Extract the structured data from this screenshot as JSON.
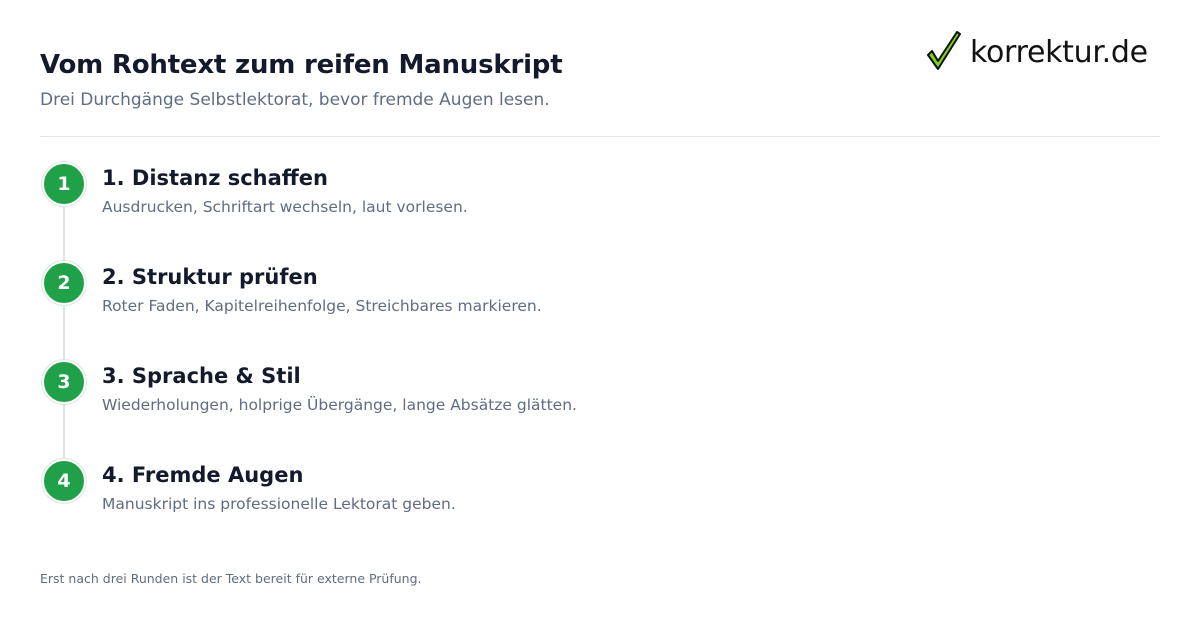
{
  "header": {
    "title": "Vom Rohtext zum reifen Manuskript",
    "subtitle": "Drei Durchgänge Selbstlektorat, bevor fremde Augen lesen."
  },
  "logo": {
    "text": "korrektur.de",
    "icon": "checkmark-icon",
    "check_color": "#7ed321"
  },
  "steps": [
    {
      "number": "1",
      "title": "1. Distanz schaffen",
      "description": "Ausdrucken, Schriftart wechseln, laut vorlesen."
    },
    {
      "number": "2",
      "title": "2. Struktur prüfen",
      "description": "Roter Faden, Kapitelreihenfolge, Streichbares markieren."
    },
    {
      "number": "3",
      "title": "3. Sprache & Stil",
      "description": "Wiederholungen, holprige Übergänge, lange Absätze glätten."
    },
    {
      "number": "4",
      "title": "4. Fremde Augen",
      "description": "Manuskript ins professionelle Lektorat geben."
    }
  ],
  "footer": {
    "note": "Erst nach drei Runden ist der Text bereit für externe Prüfung."
  },
  "colors": {
    "accent": "#21a04a",
    "title": "#121a2b",
    "muted": "#5f6d82"
  }
}
